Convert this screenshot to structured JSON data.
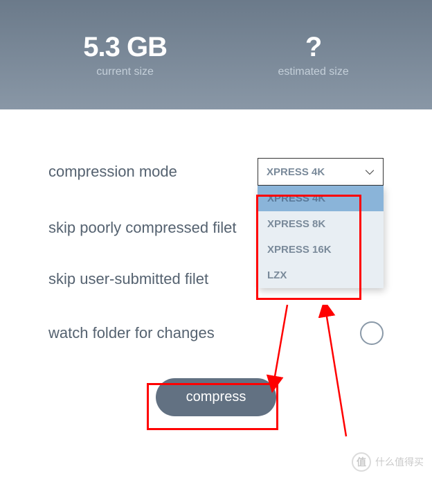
{
  "header": {
    "current": {
      "value": "5.3 GB",
      "label": "current size"
    },
    "estimated": {
      "value": "?",
      "label": "estimated size"
    }
  },
  "options": {
    "compression_mode": {
      "label": "compression mode",
      "selected": "XPRESS 4K",
      "items": [
        "XPRESS 4K",
        "XPRESS 8K",
        "XPRESS 16K",
        "LZX"
      ]
    },
    "skip_poor": {
      "label": "skip poorly compressed filet"
    },
    "skip_user": {
      "label": "skip user-submitted filet"
    },
    "watch_folder": {
      "label": "watch folder for changes"
    }
  },
  "actions": {
    "compress": "compress"
  },
  "watermark": {
    "symbol": "值",
    "text": "什么值得买"
  },
  "colors": {
    "header_gradient_top": "#6b7a8a",
    "header_gradient_bottom": "#8997a6",
    "text_primary": "#556270",
    "text_muted": "#7a8a9a",
    "button_bg": "#627182",
    "annotation": "#ff0000"
  }
}
